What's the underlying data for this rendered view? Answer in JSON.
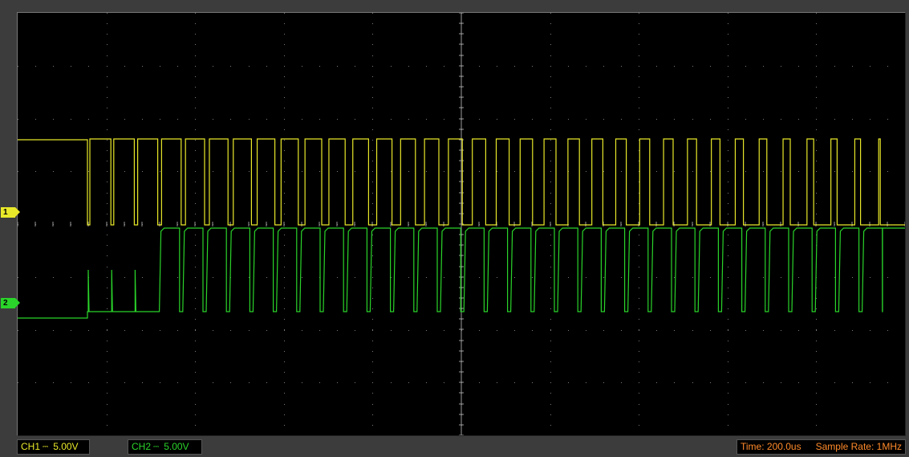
{
  "channels": [
    {
      "id": "CH1",
      "marker_label": "1",
      "coupling_icon": "dc-coupling-icon",
      "coupling_glyph": "⎓",
      "volts_per_div": "5.00V",
      "color": "#e8e82a"
    },
    {
      "id": "CH2",
      "marker_label": "2",
      "coupling_icon": "dc-coupling-icon",
      "coupling_glyph": "⎓",
      "volts_per_div": "5.00V",
      "color": "#2ad42a"
    }
  ],
  "timebase": {
    "label": "Time:",
    "value": "200.0us"
  },
  "sample_rate": {
    "label": "Sample Rate:",
    "value": "1MHz"
  },
  "colors": {
    "screen_bg": "#000000",
    "grid_dots": "#7a7a7a",
    "status_text": "#ff8a2a"
  }
}
